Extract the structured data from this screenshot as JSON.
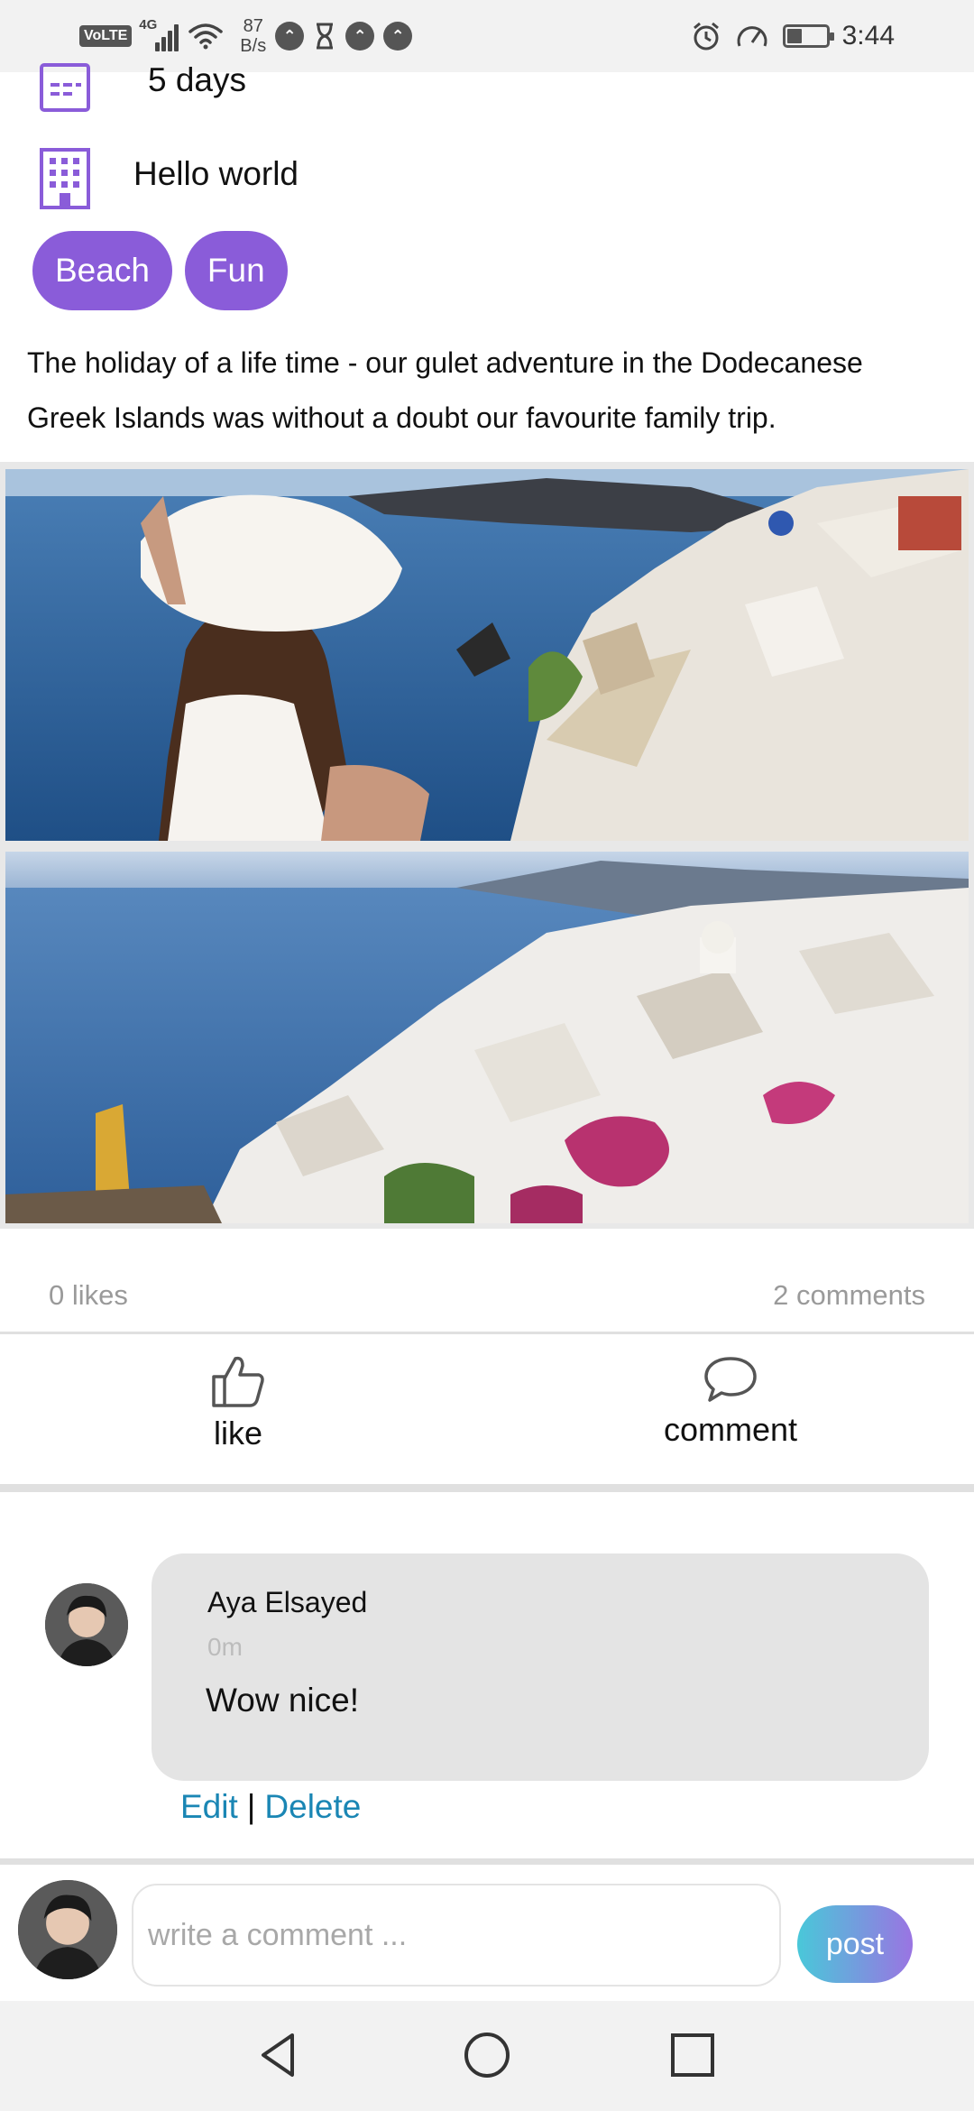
{
  "status_bar": {
    "volte": "VoLTE",
    "network": "4G",
    "speed_value": "87",
    "speed_unit": "B/s",
    "time": "3:44",
    "battery_level": 0.35,
    "icons": [
      "signal-icon",
      "wifi-icon",
      "alert-icon",
      "hourglass-icon",
      "alarm-icon",
      "speedometer-icon",
      "battery-icon"
    ]
  },
  "trip": {
    "duration": "5 days",
    "place": "Hello world",
    "tags": [
      "Beach",
      "Fun"
    ],
    "description": "The holiday of a life time - our gulet adventure in the Dodecanese Greek Islands was without a doubt our favourite family trip."
  },
  "stats": {
    "likes": "0 likes",
    "comments": "2  comments"
  },
  "actions": {
    "like_label": "like",
    "comment_label": "comment"
  },
  "comment": {
    "author": "Aya Elsayed",
    "time": "0m",
    "text": "Wow nice!",
    "edit_label": "Edit",
    "separator": "|",
    "delete_label": "Delete"
  },
  "composer": {
    "placeholder": "write a comment ...",
    "post_label": "post"
  },
  "colors": {
    "accent_purple": "#8a5cd9",
    "link_blue": "#1a86b4",
    "post_gradient": [
      "#49c8d9",
      "#9a74e2"
    ]
  }
}
